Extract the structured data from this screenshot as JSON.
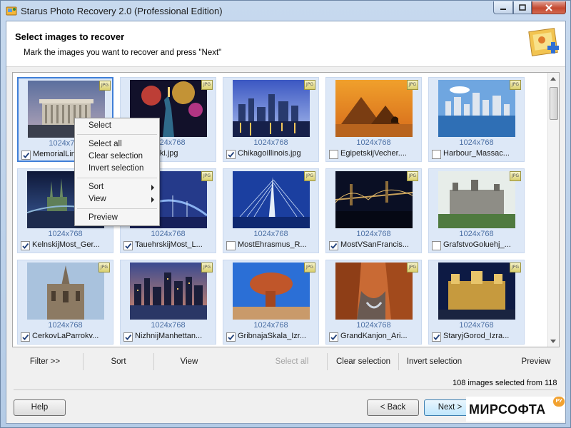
{
  "window": {
    "title": "Starus Photo Recovery 2.0 (Professional Edition)"
  },
  "header": {
    "title": "Select images to recover",
    "subtitle": "Mark the images you want to recover and press \"Next\""
  },
  "images": [
    {
      "dims": "1024x768",
      "name": "MemorialLink",
      "checked": true,
      "badge": "JPG",
      "scene": "memorial"
    },
    {
      "dims": "1024x768",
      "name": "aAmeriki.jpg",
      "checked": false,
      "badge": "JPG",
      "scene": "liberty"
    },
    {
      "dims": "1024x768",
      "name": "ChikagoIllinois.jpg",
      "checked": true,
      "badge": "JPG",
      "scene": "chicago"
    },
    {
      "dims": "1024x768",
      "name": "EgipetskijVecher....",
      "checked": false,
      "badge": "JPG",
      "scene": "pyramids"
    },
    {
      "dims": "1024x768",
      "name": "Harbour_Massac...",
      "checked": false,
      "badge": "JPG",
      "scene": "harbour"
    },
    {
      "dims": "1024x768",
      "name": "KelnskijMost_Ger...",
      "checked": true,
      "badge": "JPG",
      "scene": "cologne"
    },
    {
      "dims": "1024x768",
      "name": "TauehrskijMost_L...",
      "checked": true,
      "badge": "JPG",
      "scene": "towerbridge"
    },
    {
      "dims": "1024x768",
      "name": "MostEhrasmus_R...",
      "checked": false,
      "badge": "JPG",
      "scene": "erasmus"
    },
    {
      "dims": "1024x768",
      "name": "MostVSanFrancis...",
      "checked": true,
      "badge": "JPG",
      "scene": "sanfran"
    },
    {
      "dims": "1024x768",
      "name": "GrafstvoGoluehj_...",
      "checked": false,
      "badge": "JPG",
      "scene": "castle"
    },
    {
      "dims": "1024x768",
      "name": "CerkovLaParrokv...",
      "checked": true,
      "badge": "JPG",
      "scene": "church"
    },
    {
      "dims": "1024x768",
      "name": "NizhnijManhettan...",
      "checked": true,
      "badge": "JPG",
      "scene": "manhattan"
    },
    {
      "dims": "1024x768",
      "name": "GribnajaSkala_Izr...",
      "checked": true,
      "badge": "JPG",
      "scene": "rock"
    },
    {
      "dims": "1024x768",
      "name": "GrandKanjon_Ari...",
      "checked": true,
      "badge": "JPG",
      "scene": "canyon"
    },
    {
      "dims": "1024x768",
      "name": "StaryjGorod_Izra...",
      "checked": true,
      "badge": "JPG",
      "scene": "oldcity"
    }
  ],
  "context_menu": {
    "items": [
      {
        "label": "Select",
        "submenu": false
      },
      {
        "label": "Select all",
        "submenu": false
      },
      {
        "label": "Clear selection",
        "submenu": false
      },
      {
        "label": "Invert selection",
        "submenu": false
      },
      {
        "label": "Sort",
        "submenu": true
      },
      {
        "label": "View",
        "submenu": true
      },
      {
        "label": "Preview",
        "submenu": false
      }
    ]
  },
  "toolbar": {
    "filter": "Filter >>",
    "sort": "Sort",
    "view": "View",
    "select_all": "Select all",
    "clear_selection": "Clear selection",
    "invert_selection": "Invert selection",
    "preview": "Preview"
  },
  "status": "108 images selected from 118",
  "buttons": {
    "help": "Help",
    "back": "< Back",
    "next": "Next >"
  },
  "watermark": {
    "text": "МИРСОФТА",
    "badge": "РУ"
  },
  "colors": {
    "selection_border": "#3f7fd8",
    "tile_background": "#dde8f7",
    "dims_text": "#4b6fa4"
  }
}
